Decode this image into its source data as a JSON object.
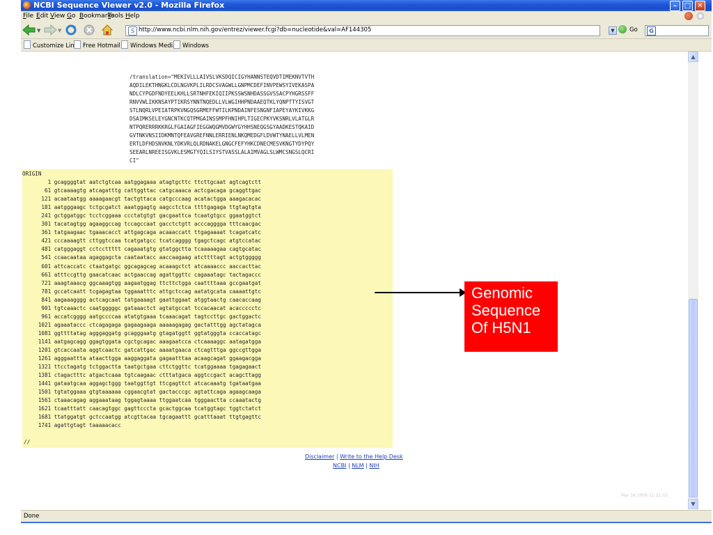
{
  "window": {
    "title": "NCBI Sequence Viewer v2.0 - Mozilla Firefox",
    "buttons": [
      "minimize",
      "maximize",
      "close"
    ]
  },
  "menu": [
    "File",
    "Edit",
    "View",
    "Go",
    "Bookmarks",
    "Tools",
    "Help"
  ],
  "navigation": {
    "url": "http://www.ncbi.nlm.nih.gov/entrez/viewer.fcgi?db=nucleotide&val=AF144305",
    "go_label": "Go",
    "icons": [
      "back-icon",
      "forward-icon",
      "reload-icon",
      "stop-icon",
      "home-icon"
    ]
  },
  "bookmarks": [
    "Customize Links",
    "Free Hotmail",
    "Windows Media",
    "Windows"
  ],
  "translation_text": "/translation=\"MEKIVLLLAIVSLVKSDQICIGYHANNSTEQVDTIMEKNVTVTH\nAQDILEKTHNGKLCDLNGVKPLILRDCSVAGWLLGNPMCDEFINVPEWSYIVEKASPA\nNDLCYPGDFNDYEELKHLLSRTNHFEKIQIIPKSSWSNHDASSGVSSACPYHGRSSFF\nRNVVWLIKKNSAYPTIKRSYNNTNQEDLLVLWGIHHPNDAAEQTKLYQNPTTYISVGT\nSTLNQRLVPEIATRPKVNGQSGRMEFFWTILKPNDAINFESNGNFIAPEYAYKIVKKG\nDSAIMKSELEYGNCNTKCQTPMGAINSSMPFHNIHPLTIGECPKYVKSNRLVLATGLR\nNTPQRERRRKKRGLFGAIAGFIEGGWQGMVDGWYGYHHSNEQGSGYAADKESTQKAID\nGVTNKVNSIIDKMNTQFEAVGREFNNLERRIENLNKQMEDGFLDVWTYNAELLVLMEN\nERTLDFHDSNVKNLYDKVRLQLRDNAKELGNGCFEFYHKCDNECMESVKNGTYDYPQY\nSEEARLNREEISGVKLESMGTYQILSIYSTVASSLALAIMVAGLSLWMCSNGSLQCRI\nCI\"",
  "sequence_text": "ORIGIN\n        1 gcaggggtat aatctgtcaa aatggagaaa atagtgcttc ttcttgcaat agtcagtctt\n       61 gtcaaaagtg atcagatttg cattggttac catgcaaaca actcgacaga gcaggttgac\n      121 acaataatgg aaaagaacgt tactgttaca catgcccaag acatactgga aaagacacac\n      181 aatgggaagc tctgcgatct aaatggagtg aagcctctca ttttgagaga ttgtagtgta\n      241 gctggatggc tcctcggaaa ccctatgtgt gacgaattca tcaatgtgcc ggaatggtct\n      301 tacatagtgg agaaggccag tccagccaat gacctctgtt acccagggga tttcaacgac\n      361 tatgaagaac tgaaacacct attgagcaga acaaaccatt ttgagaaaat tcagatcatc\n      421 cccaaaagtt cttggtccaa tcatgatgcc tcatcagggg tgagctcagc atgtccatac\n      481 catgggaggt cctccttttt cagaaatgtg gtatggctta tcaaaaagaa cagtgcatac\n      541 ccaacaataa agaggagcta caataatacc aaccaagaag atcttttagt actgtggggg\n      601 attcaccatc ctaatgatgc ggcagagcag acaaagctct atcaaaaccc aaccacttac\n      661 atttccgttg gaacatcaac actgaaccag agattggttc cagaaatagc tactagaccc\n      721 aaagtaaacg ggcaaagtgg aagaatggag ttcttctgga caattttaaa gccgaatgat\n      781 gccatcaatt tcgagagtaa tggaaatttc attgctccag aatatgcata caaaattgtc\n      841 aagaaagggg actcagcaat tatgaaaagt gaattggaat atggtaactg caacaccaag\n      901 tgtcaaactc caatgggggc gataaactct agtatgccat tccacaacat acaccccctc\n      961 accatcgggg aatgccccaa atatgtgaaa tcaaacagat tagtccttgc gactggactc\n     1021 agaaataccc ctcagagaga gagaagaaga aaaaagagag gactatttgg agctatagca\n     1081 ggttttatag agggaggatg gcagggaatg gtagatggtt ggtatgggta ccaccatagc\n     1141 aatgagcagg ggagtggata cgctgcagac aaagaatcca ctcaaaaggc aatagatgga\n     1201 gtcaccaata aggtcaactc gatcattgac aaaatgaaca ctcagtttga ggccgttgga\n     1261 agggaattta ataacttgga aaggaggata gagaatttaa acaagcagat ggaagacgga\n     1321 ttcctagatg tctggactta taatgctgaa cttctggttc tcatggaaaa tgagagaact\n     1381 ctagactttc atgactcaaa tgtcaagaac ctttatgaca aggtccgact acagcttagg\n     1441 gataatgcaa aggagctggg taatggttgt ttcgagttct atcacaaatg tgataatgaa\n     1501 tgtatggaaa gtgtaaaaaa cggaacgtat gactacccgc agtattcaga agaagcaaga\n     1561 ctaaacagag aggaaataag tggagtaaaa ttggaatcaa tgggaactta ccaaatactg\n     1621 tcaatttatt caacagtggc gagttcccta gcactggcaa tcatggtagc tggtctatct\n     1681 ttatggatgt gctccaatgg atcgttacaa tgcagaattt gcatttaaat ttgtgagttc\n     1741 agattgtagt taaaaacacc",
  "end_marker": "//",
  "footer": {
    "disclaimer": "Disclaimer",
    "separator": "|",
    "help_desk": "Write to the Help Desk",
    "ncbi": "NCBI",
    "nlm": "NLM",
    "nih": "NIH"
  },
  "annotation": {
    "line1": "Genomic",
    "line2": "Sequence",
    "line3": "Of H5N1",
    "color": "#ff0000"
  },
  "date_stamp": "Mar 16 2006 11:21:03",
  "status": "Done"
}
